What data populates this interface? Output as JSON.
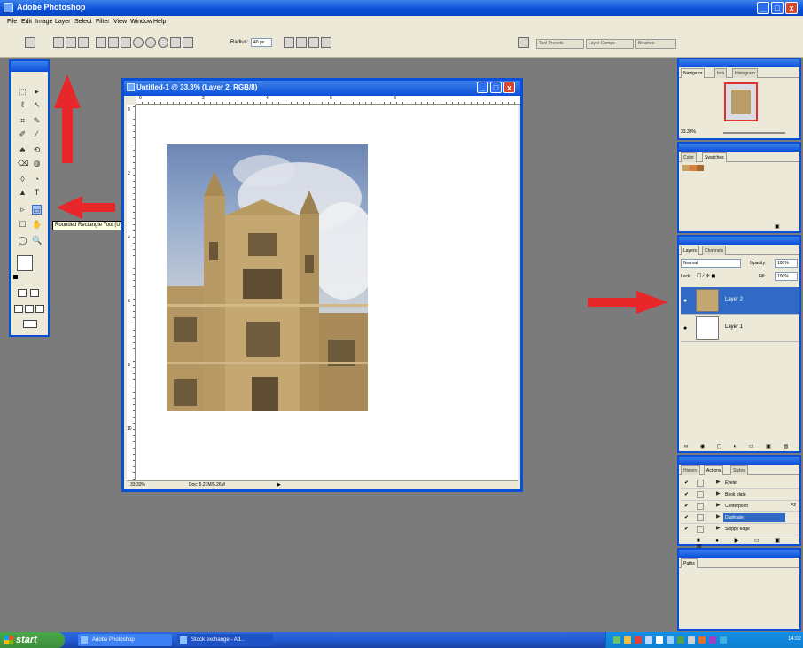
{
  "app": {
    "title": "Adobe Photoshop",
    "window_buttons": [
      "_",
      "□",
      "x"
    ]
  },
  "menu": [
    "File",
    "Edit",
    "Image",
    "Layer",
    "Select",
    "Filter",
    "View",
    "Window",
    "Help"
  ],
  "options_bar": {
    "radius_label": "Radius:",
    "radius_value": "40 px",
    "palette_well_tabs": [
      "Tool Presets",
      "Layer Comps",
      "Brushes"
    ]
  },
  "tools": {
    "tooltip": "Rounded Rectangle Tool (U)",
    "glyphs": [
      "⬚",
      "▸",
      "ℓ",
      "↖",
      "⌗",
      "✎",
      "✐",
      "⁄",
      "♣",
      "⟲",
      "⌫",
      "◍",
      "◊",
      "◔",
      "▲",
      "T",
      "▹",
      "▭",
      "☐",
      "✋",
      "◯",
      "🔍"
    ]
  },
  "document": {
    "title": "Untitled-1 @ 33.3% (Layer 2, RGB/8)",
    "zoom": "33.33%",
    "doc_size": "Doc: 5.27M/5.26M",
    "ruler_h_labels": [
      "0",
      "2",
      "4",
      "6",
      "8"
    ],
    "ruler_v_labels": [
      "0",
      "2",
      "4",
      "6",
      "8",
      "10"
    ]
  },
  "navigator_panel": {
    "tabs": [
      "Navigator",
      "Info",
      "Histogram"
    ],
    "zoom": "33.33%"
  },
  "color_panel": {
    "tabs": [
      "Color",
      "Swatches"
    ],
    "swatch_colors": [
      "#c8a060",
      "#d88040",
      "#a86830"
    ]
  },
  "layers_panel": {
    "tabs": [
      "Layers",
      "Channels"
    ],
    "blend_mode": "Normal",
    "opacity_label": "Opacity:",
    "opacity_value": "100%",
    "lock_label": "Lock:",
    "fill_label": "Fill:",
    "fill_value": "100%",
    "layers": [
      {
        "name": "Layer 2",
        "selected": true
      },
      {
        "name": "Layer 1",
        "selected": false
      }
    ]
  },
  "actions_panel": {
    "tabs": [
      "History",
      "Actions",
      "Styles"
    ],
    "actions": [
      {
        "name": "Eyelet",
        "shortcut": "",
        "selected": false
      },
      {
        "name": "Book plate",
        "shortcut": "",
        "selected": false
      },
      {
        "name": "Centerpoint",
        "shortcut": "F2",
        "selected": false
      },
      {
        "name": "Duplicate",
        "shortcut": "",
        "selected": true
      },
      {
        "name": "Sloppy edge",
        "shortcut": "",
        "selected": false
      }
    ]
  },
  "paths_panel": {
    "tabs": [
      "Paths"
    ]
  },
  "taskbar": {
    "start_label": "start",
    "tasks": [
      "Adobe Photoshop",
      "Stock exchange - Ad..."
    ],
    "clock": "14:02"
  },
  "annotations": {
    "arrow_color": "#e8272a"
  }
}
